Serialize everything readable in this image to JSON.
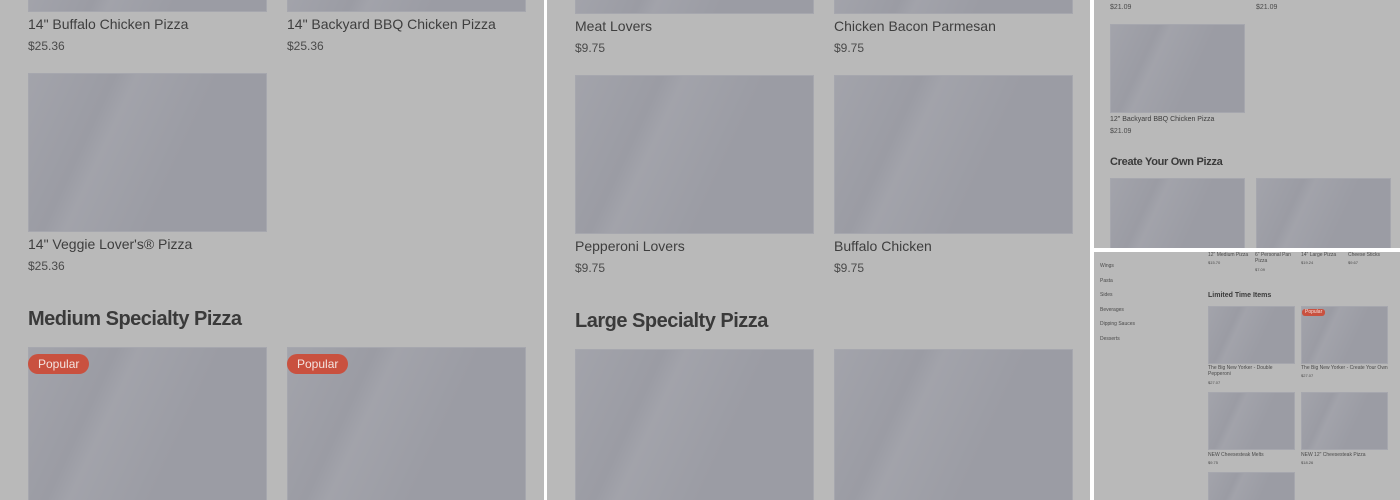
{
  "panel1": {
    "top_items": [
      {
        "name": "14\" Buffalo Chicken Pizza",
        "price": "$25.36"
      },
      {
        "name": "14\" Backyard BBQ Chicken Pizza",
        "price": "$25.36"
      }
    ],
    "veggie": {
      "name": "14\" Veggie Lover's® Pizza",
      "price": "$25.36"
    },
    "section_heading": "Medium Specialty Pizza",
    "badges": [
      "Popular",
      "Popular"
    ]
  },
  "panel2": {
    "top_items": [
      {
        "name": "Meat Lovers",
        "price": "$9.75"
      },
      {
        "name": "Chicken Bacon Parmesan",
        "price": "$9.75"
      }
    ],
    "mid_items": [
      {
        "name": "Pepperoni Lovers",
        "price": "$9.75"
      },
      {
        "name": "Buffalo Chicken",
        "price": "$9.75"
      }
    ],
    "section_heading": "Large Specialty Pizza"
  },
  "panel3": {
    "top_prices": [
      "$21.09",
      "$21.09"
    ],
    "item": {
      "name": "12\" Backyard BBQ Chicken Pizza",
      "price": "$21.09"
    },
    "section_heading": "Create Your Own Pizza"
  },
  "panel4": {
    "sidebar": [
      "Wings",
      "Pasta",
      "Sides",
      "Beverages",
      "Dipping Sauces",
      "Desserts"
    ],
    "top_items": [
      {
        "name": "12\" Medium Pizza",
        "price": "$15.70"
      },
      {
        "name": "6\" Personal Pan Pizza",
        "price": "$7.09"
      },
      {
        "name": "14\" Large Pizza",
        "price": "$19.24"
      },
      {
        "name": "Cheese Sticks",
        "price": "$9.67"
      }
    ],
    "section_heading": "Limited Time Items",
    "badge": "Popular",
    "items": [
      {
        "name": "The Big New Yorker - Double Pepperoni",
        "price": "$27.07"
      },
      {
        "name": "The Big New Yorker - Create Your Own",
        "price": "$27.07"
      },
      {
        "name": "NEW Cheesesteak Melts",
        "price": "$9.75"
      },
      {
        "name": "NEW 12\" Cheesesteak Pizza",
        "price": "$18.26"
      }
    ]
  }
}
